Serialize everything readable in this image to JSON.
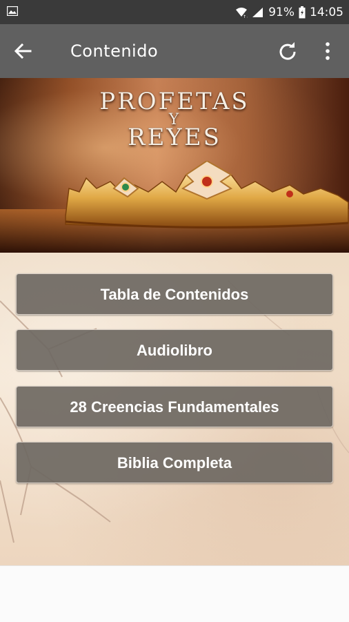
{
  "status_bar": {
    "battery_percent": "91%",
    "time": "14:05",
    "icons": [
      "image-icon",
      "wifi-icon",
      "signal-icon",
      "battery-icon"
    ]
  },
  "toolbar": {
    "title": "Contenido",
    "icons": [
      "back-arrow-icon",
      "refresh-icon",
      "more-vert-icon"
    ]
  },
  "banner": {
    "title_line1": "PROFETAS",
    "title_line2": "Y",
    "title_line3": "REYES"
  },
  "menu": {
    "items": [
      {
        "label": "Tabla de Contenidos"
      },
      {
        "label": "Audiolibro"
      },
      {
        "label": "28 Creencias Fundamentales"
      },
      {
        "label": "Biblia Completa"
      }
    ]
  },
  "colors": {
    "status_bar": "#3a3a3a",
    "toolbar": "#606060",
    "button_bg": "#6e6862",
    "content_bg": "#f1dfca"
  }
}
